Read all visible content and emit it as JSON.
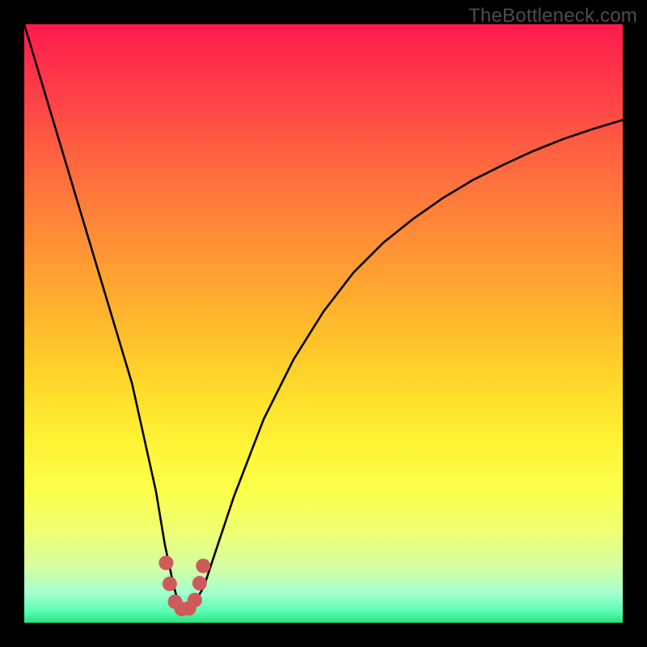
{
  "watermark": "TheBottleneck.com",
  "chart_data": {
    "type": "line",
    "title": "",
    "xlabel": "",
    "ylabel": "",
    "xlim": [
      0,
      100
    ],
    "ylim": [
      0,
      100
    ],
    "series": [
      {
        "name": "curve",
        "x": [
          0,
          3,
          6,
          9,
          12,
          15,
          18,
          20,
          22,
          23.5,
          25,
          26,
          27,
          28,
          30,
          32,
          35,
          40,
          45,
          50,
          55,
          60,
          65,
          70,
          75,
          80,
          85,
          90,
          95,
          100
        ],
        "y": [
          100,
          90,
          80,
          70,
          60,
          50,
          40,
          31,
          22,
          13,
          6,
          2.5,
          2,
          2.5,
          6,
          12,
          21,
          34,
          44,
          52,
          58.5,
          63.5,
          67.5,
          71,
          74,
          76.5,
          78.8,
          80.8,
          82.5,
          84
        ]
      }
    ],
    "markers": {
      "name": "bottom-cluster",
      "color": "#cf5a5a",
      "points": [
        {
          "x": 23.7,
          "y": 10.0
        },
        {
          "x": 24.3,
          "y": 6.5
        },
        {
          "x": 25.2,
          "y": 3.5
        },
        {
          "x": 26.3,
          "y": 2.3
        },
        {
          "x": 27.5,
          "y": 2.4
        },
        {
          "x": 28.5,
          "y": 3.8
        },
        {
          "x": 29.3,
          "y": 6.6
        },
        {
          "x": 29.9,
          "y": 9.5
        }
      ]
    },
    "background_gradient": {
      "top": "#ff1a4d",
      "mid": "#ffe13a",
      "bottom": "#25e27e"
    }
  }
}
